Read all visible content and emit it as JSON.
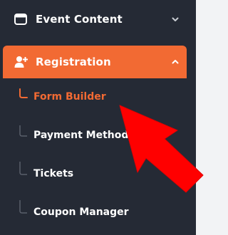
{
  "sidebar": {
    "event_content": {
      "label": "Event Content",
      "icon": "calendar-window-icon",
      "expanded": false
    },
    "registration": {
      "label": "Registration",
      "icon": "add-user-icon",
      "expanded": true,
      "accent": "#f26a33"
    },
    "registration_items": [
      {
        "label": "Form Builder",
        "active": true
      },
      {
        "label": "Payment Methods",
        "active": false
      },
      {
        "label": "Tickets",
        "active": false
      },
      {
        "label": "Coupon Manager",
        "active": false
      }
    ]
  },
  "colors": {
    "sidebar_bg": "#252a35",
    "accent": "#f26a33",
    "annotation_arrow": "#ff0000",
    "tree_line": "#5a5f6b"
  }
}
